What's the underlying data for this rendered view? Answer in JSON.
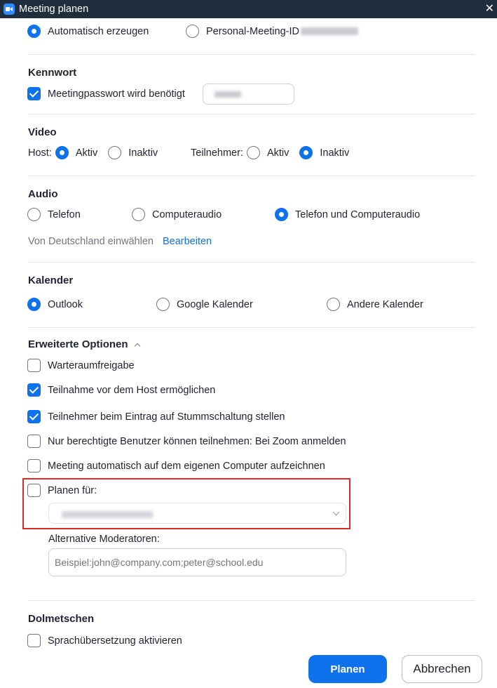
{
  "window": {
    "title": "Meeting planen"
  },
  "meeting_id": {
    "auto_label": "Automatisch erzeugen",
    "personal_label": "Personal-Meeting-ID",
    "selected": "auto"
  },
  "password": {
    "heading": "Kennwort",
    "required_label": "Meetingpasswort wird benötigt",
    "checked": true
  },
  "video": {
    "heading": "Video",
    "host_label": "Host:",
    "participants_label": "Teilnehmer:",
    "on_label": "Aktiv",
    "off_label": "Inaktiv",
    "host_selected": "on",
    "participants_selected": "off"
  },
  "audio": {
    "heading": "Audio",
    "phone_label": "Telefon",
    "computer_label": "Computeraudio",
    "both_label": "Telefon und Computeraudio",
    "selected": "both",
    "dialin_text": "Von Deutschland einwählen",
    "edit_link": "Bearbeiten"
  },
  "calendar": {
    "heading": "Kalender",
    "outlook_label": "Outlook",
    "google_label": "Google Kalender",
    "other_label": "Andere Kalender",
    "selected": "outlook"
  },
  "advanced": {
    "heading": "Erweiterte Optionen",
    "waiting_room": "Warteraumfreigabe",
    "join_before_host": "Teilnahme vor dem Host ermöglichen",
    "mute_on_entry": "Teilnehmer beim Eintrag auf Stummschaltung stellen",
    "auth_users_only": "Nur berechtigte Benutzer können teilnehmen: Bei Zoom anmelden",
    "auto_record": "Meeting automatisch auf dem eigenen Computer aufzeichnen",
    "schedule_for": "Planen für:",
    "alt_hosts_label": "Alternative Moderatoren:",
    "alt_hosts_placeholder": "Beispiel:john@company.com;peter@school.edu",
    "checked": {
      "waiting_room": false,
      "join_before_host": true,
      "mute_on_entry": true,
      "auth_users_only": false,
      "auto_record": false,
      "schedule_for": false
    }
  },
  "interpretation": {
    "heading": "Dolmetschen",
    "enable_label": "Sprachübersetzung aktivieren",
    "checked": false
  },
  "buttons": {
    "schedule": "Planen",
    "cancel": "Abbrechen"
  },
  "colors": {
    "accent": "#0e72ed",
    "titlebar": "#1f2d3d",
    "highlight_box": "#e02828"
  }
}
